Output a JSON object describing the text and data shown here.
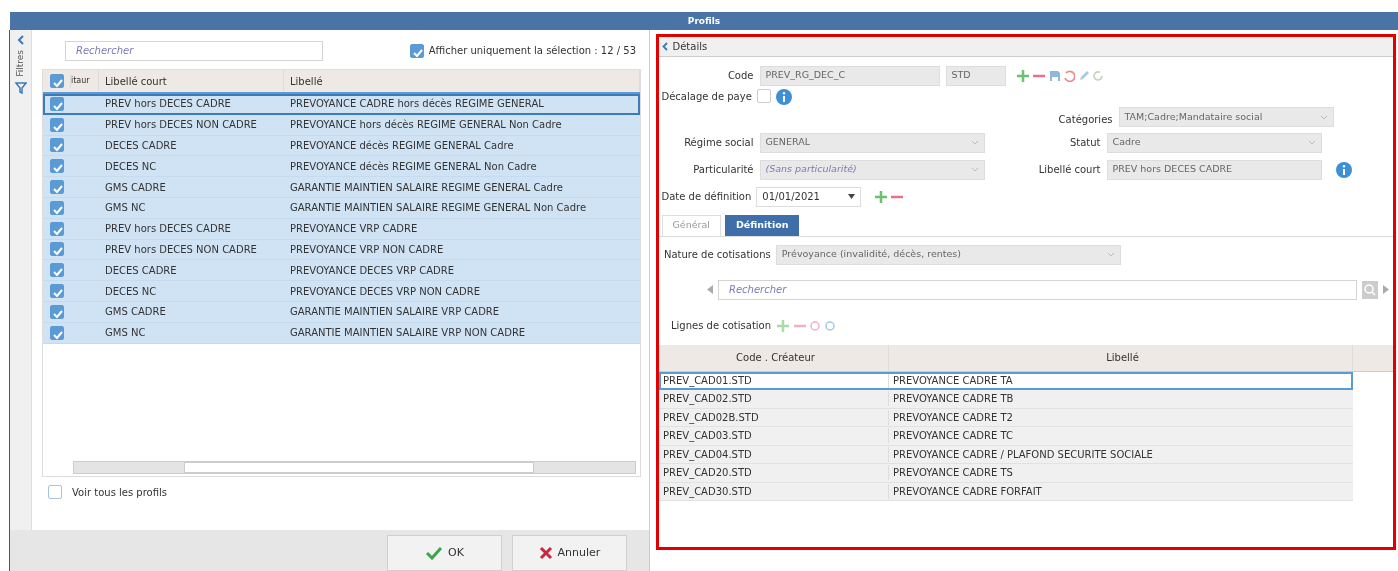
{
  "window": {
    "title": "Profils"
  },
  "filters_panel": {
    "label": "Filtres"
  },
  "profiles": {
    "search": {
      "placeholder": "Rechercher"
    },
    "show_selection": {
      "label": "Afficher uniquement la sélection : 12 / 53",
      "checked": true
    },
    "all_checked": true,
    "columns": [
      "itaur",
      "Libellé court",
      "Libellé"
    ],
    "rows": [
      {
        "short_label": "PREV hors DECES CADRE",
        "label": "PREVOYANCE CADRE hors décès  REGIME GENERAL",
        "checked": true,
        "selected": true
      },
      {
        "short_label": "PREV hors DECES NON CADRE",
        "label": "PREVOYANCE hors décès  REGIME GENERAL Non Cadre",
        "checked": true,
        "selected": false
      },
      {
        "short_label": "DECES CADRE",
        "label": "PREVOYANCE décès  REGIME GENERAL Cadre",
        "checked": true,
        "selected": false
      },
      {
        "short_label": "DECES NC",
        "label": "PREVOYANCE décès  REGIME GENERAL Non Cadre",
        "checked": true,
        "selected": false
      },
      {
        "short_label": "GMS CADRE",
        "label": "GARANTIE MAINTIEN SALAIRE  REGIME GENERAL Cadre",
        "checked": true,
        "selected": false
      },
      {
        "short_label": "GMS NC",
        "label": "GARANTIE MAINTIEN SALAIRE  REGIME GENERAL Non Cadre",
        "checked": true,
        "selected": false
      },
      {
        "short_label": "PREV hors DECES CADRE",
        "label": "PREVOYANCE  VRP CADRE",
        "checked": true,
        "selected": false
      },
      {
        "short_label": "PREV hors DECES NON CADRE",
        "label": "PREVOYANCE  VRP NON CADRE",
        "checked": true,
        "selected": false
      },
      {
        "short_label": "DECES CADRE",
        "label": "PREVOYANCE DECES  VRP CADRE",
        "checked": true,
        "selected": false
      },
      {
        "short_label": "DECES NC",
        "label": "PREVOYANCE DECES  VRP NON CADRE",
        "checked": true,
        "selected": false
      },
      {
        "short_label": "GMS CADRE",
        "label": "GARANTIE MAINTIEN SALAIRE  VRP CADRE",
        "checked": true,
        "selected": false
      },
      {
        "short_label": "GMS NC",
        "label": "GARANTIE MAINTIEN SALAIRE  VRP NON CADRE",
        "checked": true,
        "selected": false
      }
    ],
    "show_all": {
      "label": "Voir tous les profils",
      "checked": false
    }
  },
  "buttons": [
    {
      "label": "OK",
      "kind": "ok"
    },
    {
      "label": "Annuler",
      "kind": "cancel"
    }
  ],
  "details": {
    "title": "Détails",
    "code": {
      "label": "Code",
      "value": "PREV_RG_DEC_C",
      "creator": "STD"
    },
    "pay_shift": {
      "label": "Décalage de paye",
      "checked": false
    },
    "categories": {
      "label": "Catégories",
      "value": "TAM;Cadre;Mandataire social"
    },
    "regime": {
      "label": "Régime social",
      "value": "GENERAL"
    },
    "status": {
      "label": "Statut",
      "value": "Cadre"
    },
    "particularity": {
      "label": "Particularité",
      "value": "(Sans particularité)"
    },
    "short_label": {
      "label": "Libellé court",
      "value": "PREV hors DECES CADRE"
    },
    "definition_date": {
      "label": "Date de définition",
      "value": "01/01/2021"
    },
    "tabs": [
      {
        "label": "Général",
        "selected": false
      },
      {
        "label": "Définition",
        "selected": true
      }
    ],
    "nature": {
      "label": "Nature de cotisations",
      "value": "Prévoyance (invalidité, décès, rentes)"
    },
    "line_search": {
      "placeholder": "Rechercher"
    },
    "lines": {
      "label": "Lignes de cotisation",
      "columns": [
        "Code . Créateur",
        "Libellé"
      ],
      "rows": [
        {
          "code": "PREV_CAD01.STD",
          "label": "PREVOYANCE CADRE  TA",
          "selected": true
        },
        {
          "code": "PREV_CAD02.STD",
          "label": "PREVOYANCE CADRE  TB",
          "selected": false
        },
        {
          "code": "PREV_CAD02B.STD",
          "label": "PREVOYANCE CADRE  T2",
          "selected": false
        },
        {
          "code": "PREV_CAD03.STD",
          "label": "PREVOYANCE CADRE  TC",
          "selected": false
        },
        {
          "code": "PREV_CAD04.STD",
          "label": "PREVOYANCE CADRE / PLAFOND SECURITE SOCIALE",
          "selected": false
        },
        {
          "code": "PREV_CAD20.STD",
          "label": "PREVOYANCE CADRE  TS",
          "selected": false
        },
        {
          "code": "PREV_CAD30.STD",
          "label": "PREVOYANCE CADRE FORFAIT",
          "selected": false
        }
      ]
    }
  }
}
